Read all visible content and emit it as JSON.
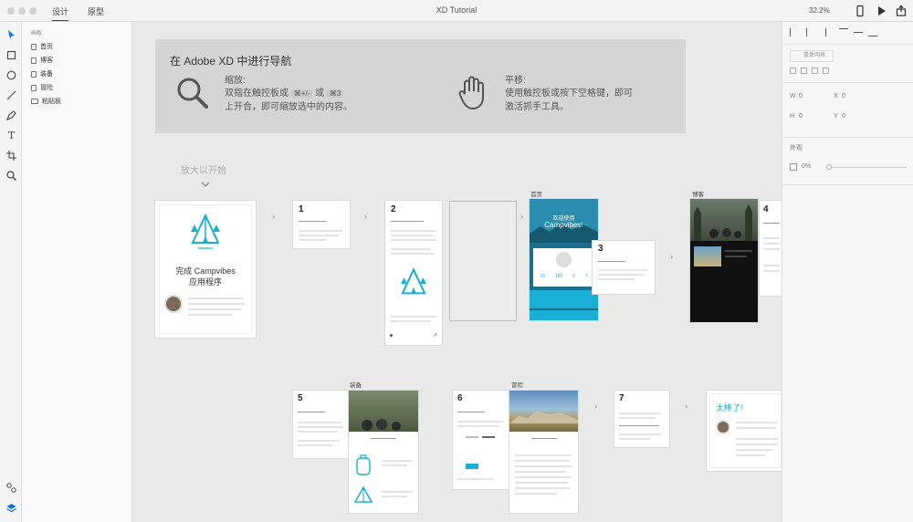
{
  "titlebar": {
    "tabs": [
      "设计",
      "原型"
    ],
    "title": "XD Tutorial",
    "zoom": "32.2%",
    "icons": [
      "device-preview-icon",
      "play-icon",
      "share-icon"
    ]
  },
  "tools": [
    "select-icon",
    "rectangle-icon",
    "ellipse-icon",
    "line-icon",
    "pen-icon",
    "text-icon",
    "artboard-icon",
    "zoom-icon"
  ],
  "tools_bottom": [
    "assets-icon",
    "layers-icon"
  ],
  "layers": {
    "heading": "画板",
    "items": [
      "首页",
      "博客",
      "装备",
      "冒险",
      "粘贴板"
    ]
  },
  "props": {
    "repeat_grid": "重复网格",
    "w_label": "W",
    "w_value": "0",
    "x_label": "X",
    "x_value": "0",
    "h_label": "H",
    "h_value": "0",
    "y_label": "Y",
    "y_value": "0",
    "appearance": "外观",
    "opacity": "0%"
  },
  "banner": {
    "title": "在 Adobe XD 中进行导航",
    "zoom_title": "缩放:",
    "zoom_line1_pre": "双指在触控板或",
    "zoom_key1": "⌘+/-",
    "zoom_or": "或",
    "zoom_key2": "⌘3",
    "zoom_line2": "上开合，即可缩放选中的内容。",
    "pan_title": "平移:",
    "pan_line1": "使用触控板或按下空格键，即可",
    "pan_line2": "激活抓手工具。"
  },
  "start_label": "放大以开始",
  "cover": {
    "title1": "完成 Campvibes",
    "title2": "应用程序"
  },
  "artboard_labels": {
    "home": "首页",
    "blog": "博客",
    "gear": "装备",
    "adventure": "冒险"
  },
  "steps": [
    "1",
    "2",
    "3",
    "4",
    "5",
    "6",
    "7"
  ],
  "home_screen": {
    "welcome": "欢迎使用",
    "brand": "Campvibes!",
    "stats": [
      "16",
      "160",
      "5",
      "7"
    ]
  },
  "final": {
    "title": "太棒了!"
  },
  "accent_colors": {
    "teal": "#1ab0d6",
    "dark": "#1a1a1a",
    "selection": "#1473e6"
  }
}
